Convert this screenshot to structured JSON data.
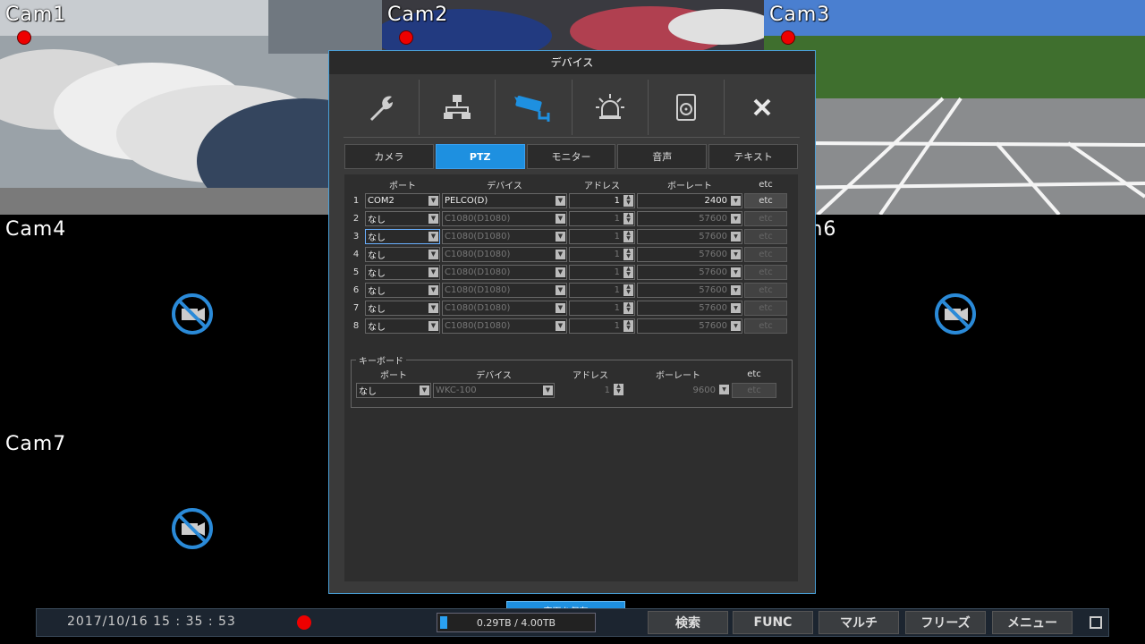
{
  "cameras": [
    {
      "label": "Cam1",
      "recording": true
    },
    {
      "label": "Cam2",
      "recording": true
    },
    {
      "label": "Cam3",
      "recording": true
    },
    {
      "label": "Cam4"
    },
    {
      "label": "m6"
    },
    {
      "label": "Cam7"
    }
  ],
  "dialog": {
    "title": "デバイス",
    "toolbar_icons": [
      "wrench-icon",
      "network-icon",
      "camera-icon",
      "alarm-icon",
      "storage-icon",
      "close-icon"
    ],
    "tabs": [
      "カメラ",
      "PTZ",
      "モニター",
      "音声",
      "テキスト"
    ],
    "active_tab": "PTZ",
    "ptz_table": {
      "headers": [
        "ポート",
        "デバイス",
        "アドレス",
        "ボーレート",
        "etc"
      ],
      "rows": [
        {
          "n": "1",
          "port": "COM2",
          "device": "PELCO(D)",
          "address": "1",
          "baud": "2400",
          "etc": "etc"
        },
        {
          "n": "2",
          "port": "なし",
          "device": "C1080(D1080)",
          "address": "1",
          "baud": "57600",
          "etc": "etc"
        },
        {
          "n": "3",
          "port": "なし",
          "device": "C1080(D1080)",
          "address": "1",
          "baud": "57600",
          "etc": "etc"
        },
        {
          "n": "4",
          "port": "なし",
          "device": "C1080(D1080)",
          "address": "1",
          "baud": "57600",
          "etc": "etc"
        },
        {
          "n": "5",
          "port": "なし",
          "device": "C1080(D1080)",
          "address": "1",
          "baud": "57600",
          "etc": "etc"
        },
        {
          "n": "6",
          "port": "なし",
          "device": "C1080(D1080)",
          "address": "1",
          "baud": "57600",
          "etc": "etc"
        },
        {
          "n": "7",
          "port": "なし",
          "device": "C1080(D1080)",
          "address": "1",
          "baud": "57600",
          "etc": "etc"
        },
        {
          "n": "8",
          "port": "なし",
          "device": "C1080(D1080)",
          "address": "1",
          "baud": "57600",
          "etc": "etc"
        }
      ]
    },
    "keyboard": {
      "legend": "キーボード",
      "headers": [
        "ポート",
        "デバイス",
        "アドレス",
        "ボーレート",
        "etc"
      ],
      "row": {
        "port": "なし",
        "device": "WKC-100",
        "address": "1",
        "baud": "9600",
        "etc": "etc"
      }
    },
    "save_label": "変更を保存"
  },
  "statusbar": {
    "datetime": "2017/10/16  15 : 35 : 53",
    "storage": "0.29TB / 4.00TB",
    "storage_used_fraction": 0.0725,
    "buttons": [
      "検索",
      "FUNC",
      "マルチ",
      "フリーズ",
      "メニュー"
    ]
  }
}
